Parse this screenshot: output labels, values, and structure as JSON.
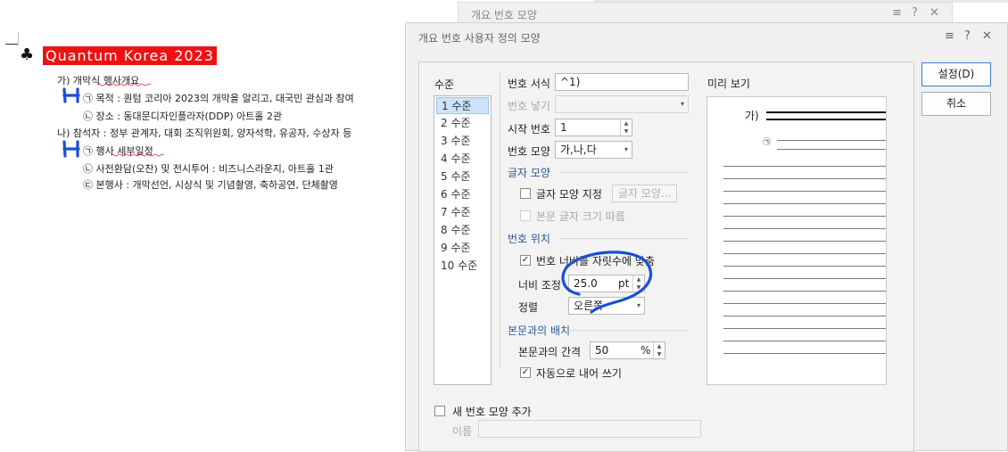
{
  "document": {
    "title": "Quantum Korea 2023",
    "title_bullet": "♣",
    "lines": [
      "가) 개막식 행사개요",
      "㉠ 목적 : 퀀텀 코리아 2023의 개막을 알리고, 대국민 관심과 참여",
      "㉡ 장소 : 동대문디자인플라자(DDP) 아트홀 2관",
      "나) 참석자 : 정부 관계자, 대회 조직위원회, 양자석학, 유공자, 수상자 등",
      "㉠ 행사 세부일정",
      "㉡ 사전환담(오찬) 및 전시투어 : 비즈니스라운지, 아트홀 1관",
      "㉢ 본행사 : 개막선언, 시상식 및 기념촬영, 축하공연, 단체촬영"
    ],
    "colors": {
      "title_bg": "#ee1111",
      "annotation": "#1a4fd6"
    }
  },
  "back_dialog": {
    "title": "개요 번호 모양",
    "controls": [
      "≡",
      "?",
      "✕"
    ]
  },
  "dialog": {
    "title": "개요 번호 사용자 정의 모양",
    "controls": [
      "≡",
      "?",
      "✕"
    ],
    "level_header": "수준",
    "levels": [
      "1 수준",
      "2 수준",
      "3 수준",
      "4 수준",
      "5 수준",
      "6 수준",
      "7 수준",
      "8 수준",
      "9 수준",
      "10 수준"
    ],
    "selected_level": "1 수준",
    "number_format_label": "번호 서식",
    "number_format_value": "^1)",
    "insert_number_label": "번호 넣기",
    "start_number_label": "시작 번호",
    "start_number_value": "1",
    "number_shape_label": "번호 모양",
    "number_shape_value": "가,나,다",
    "char_section": "글자 모양",
    "char_shape_check_label": "글자 모양 지정",
    "char_shape_button": "글자 모양...",
    "follow_body_size_label": "본문 글자 크기 따름",
    "number_pos_section": "번호 위치",
    "fit_width_label": "번호 너비를 자릿수에 맞춤",
    "width_adjust_label": "너비 조정",
    "width_value": "25.0",
    "width_unit": "pt",
    "align_label": "정렬",
    "align_value": "오른쪽",
    "body_section": "본문과의 배치",
    "body_gap_label": "본문과의 간격",
    "body_gap_value": "50",
    "body_gap_unit": "%",
    "auto_indent_label": "자동으로 내어 쓰기",
    "preview_label": "미리 보기",
    "preview_first": "가)",
    "preview_second": "㉠",
    "ok_button": "설정(D)",
    "cancel_button": "취소",
    "new_shape_label": "새 번호 모양 추가",
    "name_label": "이름"
  }
}
